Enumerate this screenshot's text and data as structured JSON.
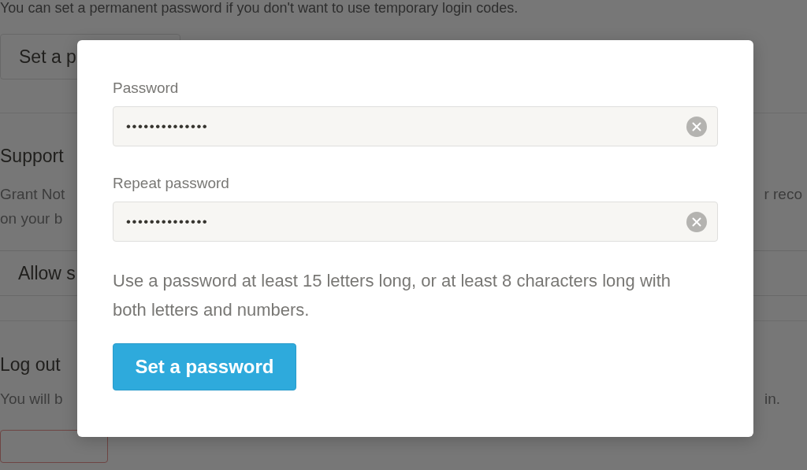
{
  "background": {
    "intro": "You can set a permanent password if you don't want to use temporary login codes.",
    "set_password_button": "Set a p",
    "support": {
      "heading": "Support",
      "description_left": [
        "Grant Not",
        "on your b"
      ],
      "description_right": "r reco"
    },
    "allow_button": "Allow s",
    "log_out": {
      "heading": "Log out",
      "description_left": "You will b",
      "description_right": "in."
    }
  },
  "dialog": {
    "fields": [
      {
        "label": "Password",
        "value": "••••••••••••••"
      },
      {
        "label": "Repeat password",
        "value": "••••••••••••••"
      }
    ],
    "hint": "Use a password at least 15 letters long, or at least 8 characters long with both letters and numbers.",
    "submit": "Set a password"
  }
}
